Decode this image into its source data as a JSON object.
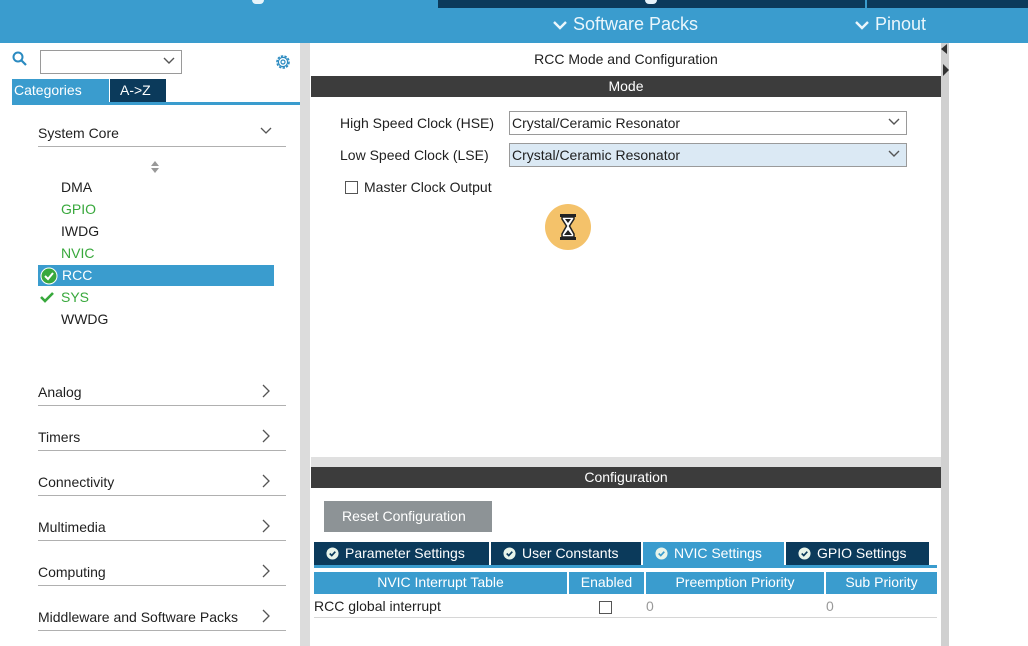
{
  "topbar": {
    "software_packs": "Software Packs",
    "pinout": "Pinout"
  },
  "left": {
    "search": {
      "value": "",
      "placeholder": ""
    },
    "tabs": {
      "categories": "Categories",
      "atoz": "A->Z"
    },
    "system_core": {
      "label": "System Core",
      "items": [
        {
          "label": "DMA",
          "state": "normal"
        },
        {
          "label": "GPIO",
          "state": "configured"
        },
        {
          "label": "IWDG",
          "state": "normal"
        },
        {
          "label": "NVIC",
          "state": "configured"
        },
        {
          "label": "RCC",
          "state": "selected-ok"
        },
        {
          "label": "SYS",
          "state": "ok"
        },
        {
          "label": "WWDG",
          "state": "normal"
        }
      ]
    },
    "categories": [
      {
        "label": "Analog"
      },
      {
        "label": "Timers"
      },
      {
        "label": "Connectivity"
      },
      {
        "label": "Multimedia"
      },
      {
        "label": "Computing"
      },
      {
        "label": "Middleware and Software Packs"
      }
    ]
  },
  "right": {
    "title": "RCC Mode and Configuration",
    "mode_header": "Mode",
    "hse_label": "High Speed Clock (HSE)",
    "hse_value": "Crystal/Ceramic Resonator",
    "lse_label": "Low Speed Clock (LSE)",
    "lse_value": "Crystal/Ceramic Resonator",
    "mco_label": "Master Clock Output",
    "config_header": "Configuration",
    "reset_button": "Reset Configuration",
    "param_tabs": [
      "Parameter Settings",
      "User Constants",
      "NVIC Settings",
      "GPIO Settings"
    ],
    "active_tab": "NVIC Settings",
    "table": {
      "headers": [
        "NVIC Interrupt Table",
        "Enabled",
        "Preemption Priority",
        "Sub Priority"
      ],
      "rows": [
        {
          "name": "RCC global interrupt",
          "enabled": false,
          "preemption": "0",
          "sub": "0"
        }
      ]
    }
  },
  "colors": {
    "accent": "#3a9cce",
    "dark": "#0b3a5b",
    "configured_green": "#38a83c",
    "header_dark": "#3c3c3c",
    "busy_indicator": "#f4c26a"
  }
}
